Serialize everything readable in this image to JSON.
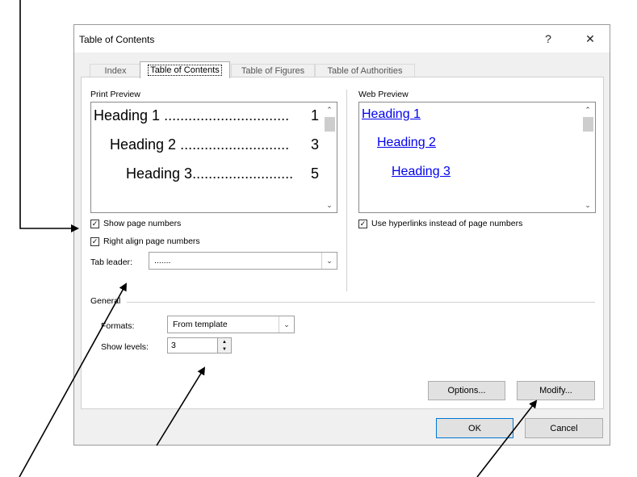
{
  "dialog": {
    "title": "Table of Contents",
    "help_label": "?",
    "close_label": "✕"
  },
  "tabs": [
    {
      "label": "Index",
      "active": false
    },
    {
      "label": "Table of Contents",
      "active": true
    },
    {
      "label": "Table of Figures",
      "active": false
    },
    {
      "label": "Table of Authorities",
      "active": false
    }
  ],
  "print_preview": {
    "label": "Print Preview",
    "entries": [
      {
        "text": "Heading 1 ...............................",
        "page": "1"
      },
      {
        "text": "Heading 2 ...........................",
        "page": "3"
      },
      {
        "text": "Heading 3.........................",
        "page": "5"
      }
    ]
  },
  "web_preview": {
    "label": "Web Preview",
    "links": [
      "Heading 1",
      "Heading 2",
      "Heading 3"
    ]
  },
  "options": {
    "show_page_numbers": {
      "label": "Show page numbers",
      "checked": true
    },
    "right_align": {
      "label": "Right align page numbers",
      "checked": true
    },
    "use_hyperlinks": {
      "label": "Use hyperlinks instead of page numbers",
      "checked": true
    },
    "tab_leader": {
      "label": "Tab leader:",
      "value": "......."
    }
  },
  "general": {
    "label": "General",
    "formats": {
      "label": "Formats:",
      "value": "From template"
    },
    "show_levels": {
      "label": "Show levels:",
      "value": "3"
    }
  },
  "buttons": {
    "options": "Options...",
    "modify": "Modify...",
    "ok": "OK",
    "cancel": "Cancel"
  },
  "glyphs": {
    "check": "✓",
    "down": "⌄",
    "up": "⌃",
    "tri_up": "▲",
    "tri_down": "▼"
  },
  "colors": {
    "hyperlink": "#0000ee",
    "default_button_border": "#0078d7"
  }
}
